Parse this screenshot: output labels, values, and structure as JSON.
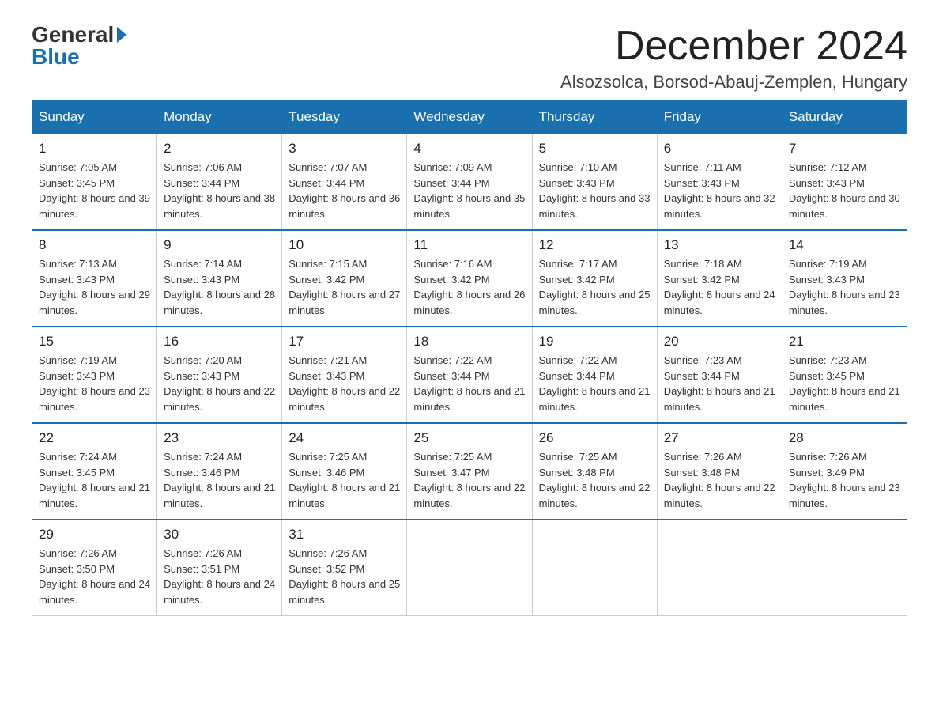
{
  "header": {
    "logo_general": "General",
    "logo_blue": "Blue",
    "title": "December 2024",
    "subtitle": "Alsozsolca, Borsod-Abauj-Zemplen, Hungary"
  },
  "weekdays": [
    "Sunday",
    "Monday",
    "Tuesday",
    "Wednesday",
    "Thursday",
    "Friday",
    "Saturday"
  ],
  "weeks": [
    [
      {
        "day": "1",
        "sunrise": "7:05 AM",
        "sunset": "3:45 PM",
        "daylight": "8 hours and 39 minutes."
      },
      {
        "day": "2",
        "sunrise": "7:06 AM",
        "sunset": "3:44 PM",
        "daylight": "8 hours and 38 minutes."
      },
      {
        "day": "3",
        "sunrise": "7:07 AM",
        "sunset": "3:44 PM",
        "daylight": "8 hours and 36 minutes."
      },
      {
        "day": "4",
        "sunrise": "7:09 AM",
        "sunset": "3:44 PM",
        "daylight": "8 hours and 35 minutes."
      },
      {
        "day": "5",
        "sunrise": "7:10 AM",
        "sunset": "3:43 PM",
        "daylight": "8 hours and 33 minutes."
      },
      {
        "day": "6",
        "sunrise": "7:11 AM",
        "sunset": "3:43 PM",
        "daylight": "8 hours and 32 minutes."
      },
      {
        "day": "7",
        "sunrise": "7:12 AM",
        "sunset": "3:43 PM",
        "daylight": "8 hours and 30 minutes."
      }
    ],
    [
      {
        "day": "8",
        "sunrise": "7:13 AM",
        "sunset": "3:43 PM",
        "daylight": "8 hours and 29 minutes."
      },
      {
        "day": "9",
        "sunrise": "7:14 AM",
        "sunset": "3:43 PM",
        "daylight": "8 hours and 28 minutes."
      },
      {
        "day": "10",
        "sunrise": "7:15 AM",
        "sunset": "3:42 PM",
        "daylight": "8 hours and 27 minutes."
      },
      {
        "day": "11",
        "sunrise": "7:16 AM",
        "sunset": "3:42 PM",
        "daylight": "8 hours and 26 minutes."
      },
      {
        "day": "12",
        "sunrise": "7:17 AM",
        "sunset": "3:42 PM",
        "daylight": "8 hours and 25 minutes."
      },
      {
        "day": "13",
        "sunrise": "7:18 AM",
        "sunset": "3:42 PM",
        "daylight": "8 hours and 24 minutes."
      },
      {
        "day": "14",
        "sunrise": "7:19 AM",
        "sunset": "3:43 PM",
        "daylight": "8 hours and 23 minutes."
      }
    ],
    [
      {
        "day": "15",
        "sunrise": "7:19 AM",
        "sunset": "3:43 PM",
        "daylight": "8 hours and 23 minutes."
      },
      {
        "day": "16",
        "sunrise": "7:20 AM",
        "sunset": "3:43 PM",
        "daylight": "8 hours and 22 minutes."
      },
      {
        "day": "17",
        "sunrise": "7:21 AM",
        "sunset": "3:43 PM",
        "daylight": "8 hours and 22 minutes."
      },
      {
        "day": "18",
        "sunrise": "7:22 AM",
        "sunset": "3:44 PM",
        "daylight": "8 hours and 21 minutes."
      },
      {
        "day": "19",
        "sunrise": "7:22 AM",
        "sunset": "3:44 PM",
        "daylight": "8 hours and 21 minutes."
      },
      {
        "day": "20",
        "sunrise": "7:23 AM",
        "sunset": "3:44 PM",
        "daylight": "8 hours and 21 minutes."
      },
      {
        "day": "21",
        "sunrise": "7:23 AM",
        "sunset": "3:45 PM",
        "daylight": "8 hours and 21 minutes."
      }
    ],
    [
      {
        "day": "22",
        "sunrise": "7:24 AM",
        "sunset": "3:45 PM",
        "daylight": "8 hours and 21 minutes."
      },
      {
        "day": "23",
        "sunrise": "7:24 AM",
        "sunset": "3:46 PM",
        "daylight": "8 hours and 21 minutes."
      },
      {
        "day": "24",
        "sunrise": "7:25 AM",
        "sunset": "3:46 PM",
        "daylight": "8 hours and 21 minutes."
      },
      {
        "day": "25",
        "sunrise": "7:25 AM",
        "sunset": "3:47 PM",
        "daylight": "8 hours and 22 minutes."
      },
      {
        "day": "26",
        "sunrise": "7:25 AM",
        "sunset": "3:48 PM",
        "daylight": "8 hours and 22 minutes."
      },
      {
        "day": "27",
        "sunrise": "7:26 AM",
        "sunset": "3:48 PM",
        "daylight": "8 hours and 22 minutes."
      },
      {
        "day": "28",
        "sunrise": "7:26 AM",
        "sunset": "3:49 PM",
        "daylight": "8 hours and 23 minutes."
      }
    ],
    [
      {
        "day": "29",
        "sunrise": "7:26 AM",
        "sunset": "3:50 PM",
        "daylight": "8 hours and 24 minutes."
      },
      {
        "day": "30",
        "sunrise": "7:26 AM",
        "sunset": "3:51 PM",
        "daylight": "8 hours and 24 minutes."
      },
      {
        "day": "31",
        "sunrise": "7:26 AM",
        "sunset": "3:52 PM",
        "daylight": "8 hours and 25 minutes."
      },
      null,
      null,
      null,
      null
    ]
  ]
}
